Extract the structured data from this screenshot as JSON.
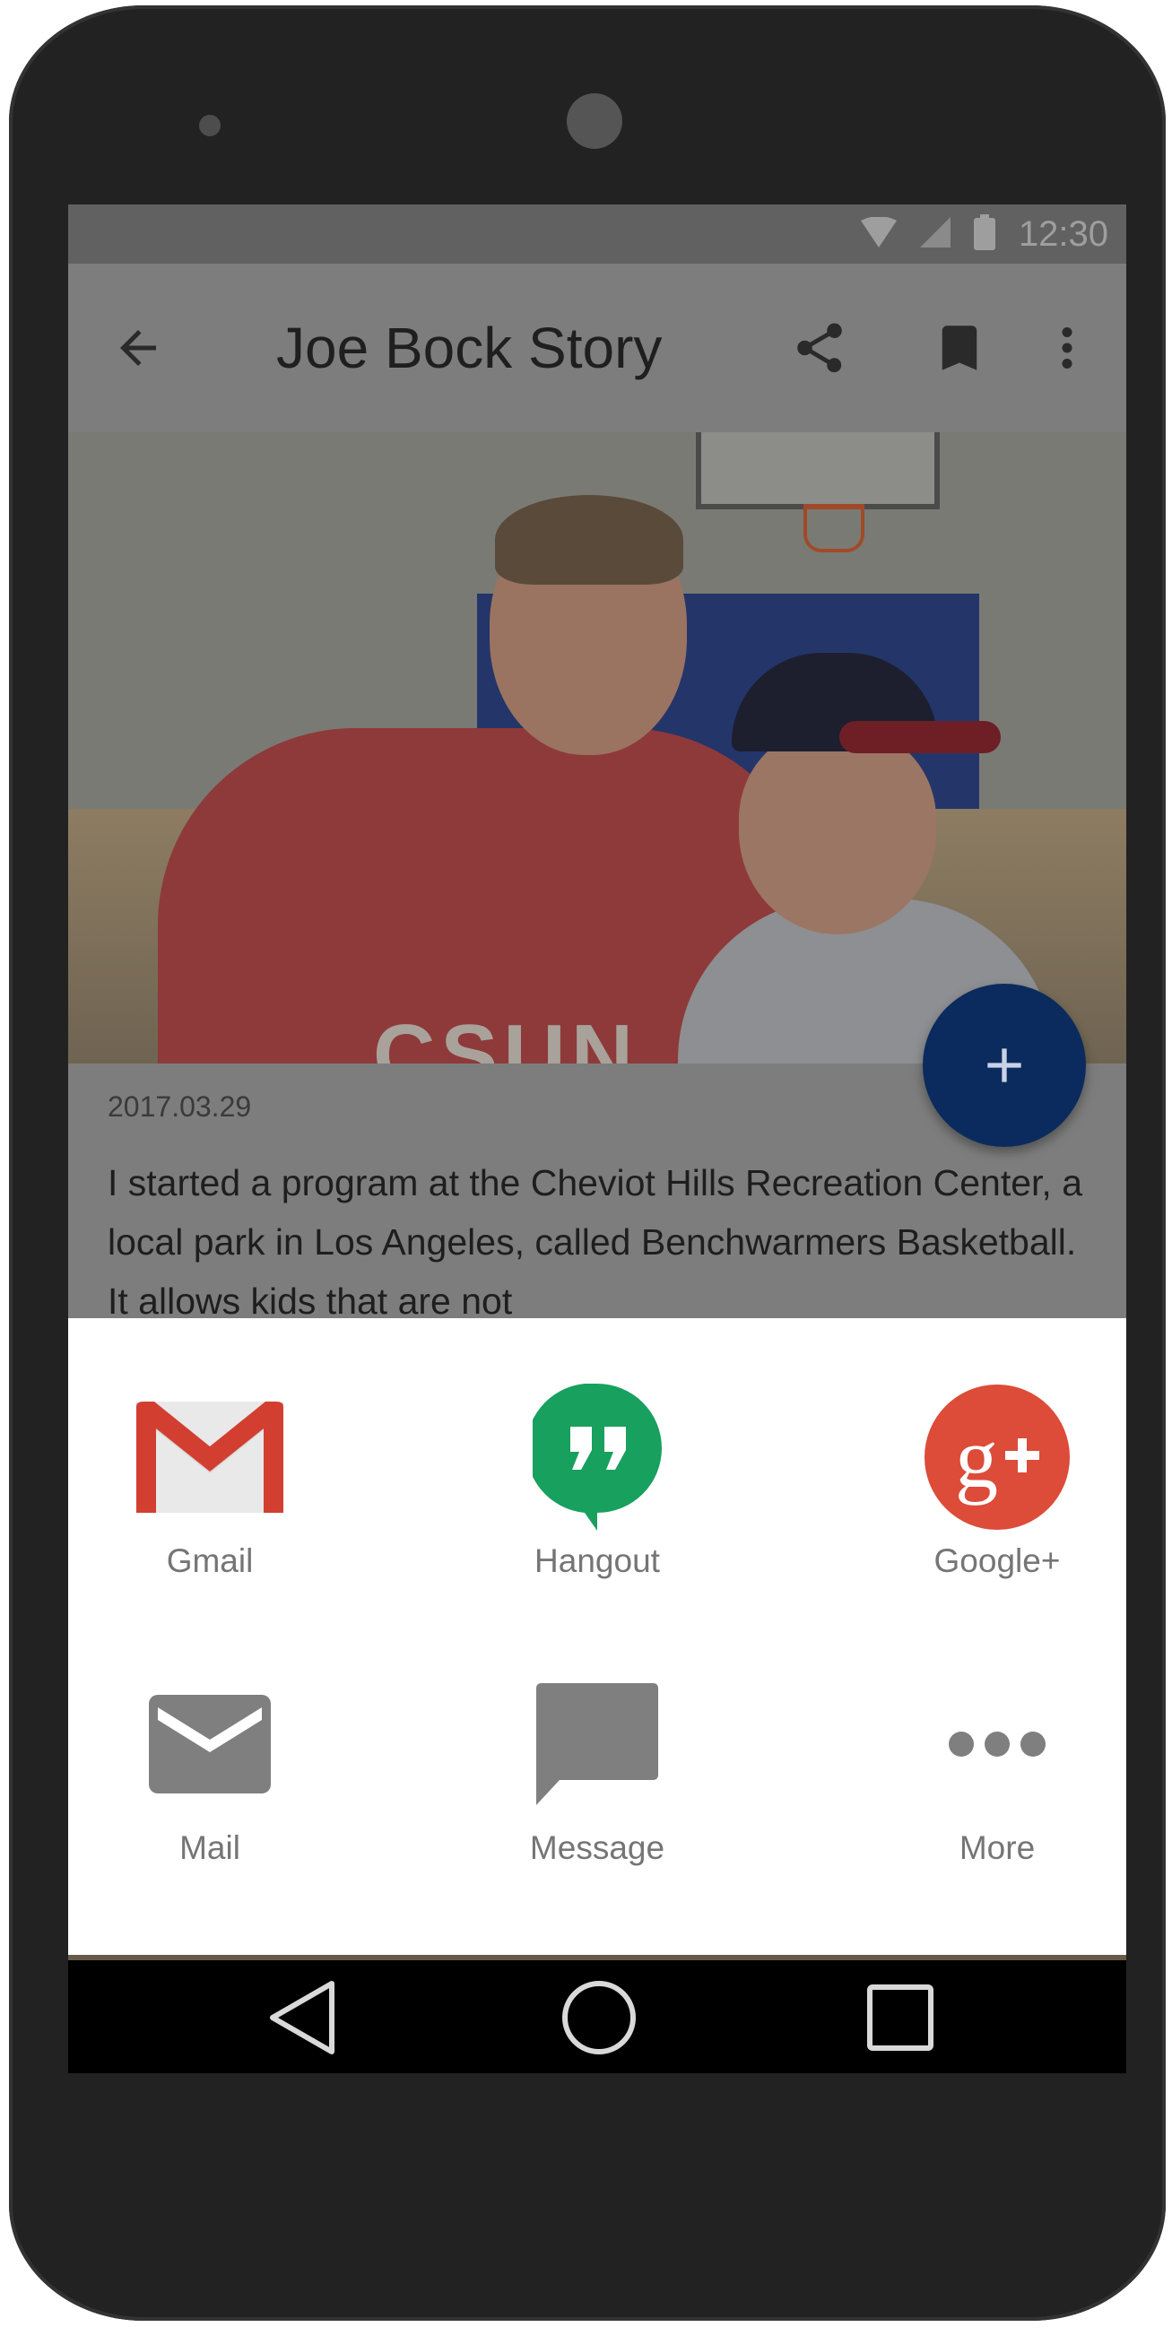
{
  "statusbar": {
    "time": "12:30",
    "icons": [
      "wifi-icon",
      "signal-icon",
      "battery-icon"
    ]
  },
  "appbar": {
    "title": "Joe Bock Story",
    "back_icon": "arrow-back-icon",
    "share_icon": "share-icon",
    "bookmark_icon": "bookmark-icon",
    "more_icon": "more-vert-icon"
  },
  "article": {
    "date": "2017.03.29",
    "body": "I started a program at the Cheviot Hills Recreation Center, a local park in Los Angeles, called Benchwarmers Basketball. It allows kids that are not",
    "photo_shirt_text": "CSUN"
  },
  "fab": {
    "icon": "plus-icon",
    "color": "#0b2b5e"
  },
  "share_sheet": {
    "items": [
      {
        "label": "Gmail",
        "icon": "gmail-icon"
      },
      {
        "label": "Hangout",
        "icon": "hangouts-icon"
      },
      {
        "label": "Google+",
        "icon": "google-plus-icon"
      },
      {
        "label": "Mail",
        "icon": "mail-icon"
      },
      {
        "label": "Message",
        "icon": "message-icon"
      },
      {
        "label": "More",
        "icon": "more-horiz-icon"
      }
    ]
  },
  "navbar": {
    "icons": [
      "nav-back-icon",
      "nav-home-icon",
      "nav-recents-icon"
    ]
  }
}
